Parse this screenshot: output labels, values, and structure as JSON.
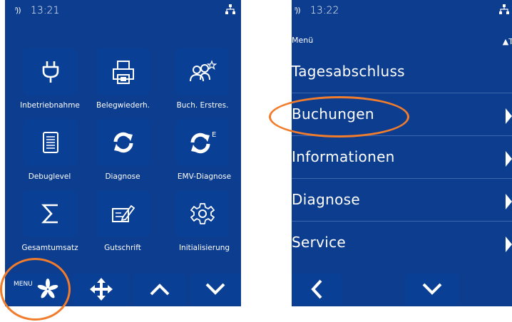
{
  "left_screen": {
    "time": "13:21",
    "signal_icon": "signal-icon",
    "network_icon": "network-icon",
    "tiles": [
      {
        "label": "Inbetriebnahme",
        "icon": "plug-icon"
      },
      {
        "label": "Belegwiederh.",
        "icon": "printer-icon"
      },
      {
        "label": "Buch. Erstres.",
        "icon": "people-star-icon"
      },
      {
        "label": "Debuglevel",
        "icon": "document-icon"
      },
      {
        "label": "Diagnose",
        "icon": "refresh-icon"
      },
      {
        "label": "EMV-Diagnose",
        "icon": "refresh-e-icon"
      },
      {
        "label": "Gesamtumsatz",
        "icon": "sigma-icon"
      },
      {
        "label": "Gutschrift",
        "icon": "edit-icon"
      },
      {
        "label": "Initialisierung",
        "icon": "gear-icon"
      }
    ],
    "bottom": {
      "menu_label": "MENU",
      "move_icon": "move-icon",
      "up_icon": "chevron-up-icon",
      "down_icon": "chevron-down-icon"
    }
  },
  "right_screen": {
    "time": "13:22",
    "header": "Menü",
    "user_label": "T",
    "items": [
      {
        "label": "Tagesabschluss",
        "has_arrow": false
      },
      {
        "label": "Buchungen",
        "has_arrow": true
      },
      {
        "label": "Informationen",
        "has_arrow": true
      },
      {
        "label": "Diagnose",
        "has_arrow": true
      },
      {
        "label": "Service",
        "has_arrow": true
      }
    ],
    "bottom": {
      "back_icon": "chevron-left-icon",
      "down_icon": "chevron-down-icon"
    }
  },
  "highlight_color": "#f07c2c",
  "screen_color": "#0d3d8f"
}
